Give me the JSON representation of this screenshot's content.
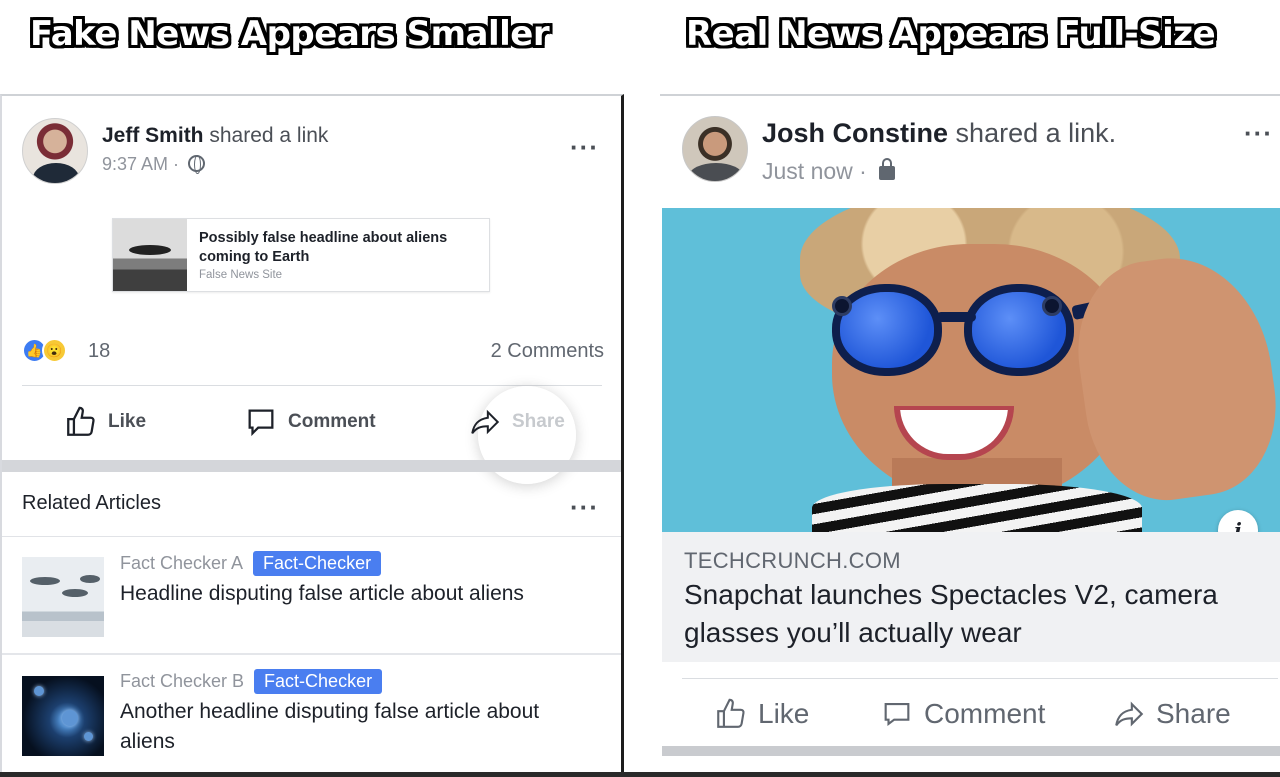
{
  "headings": {
    "left": "Fake News Appears Smaller",
    "right": "Real News Appears Full-Size"
  },
  "fake_post": {
    "author": "Jeff Smith",
    "action": "shared a link",
    "time": "9:37 AM ·",
    "privacy_icon": "globe-icon",
    "link": {
      "title": "Possibly false headline about aliens coming to Earth",
      "source": "False News Site"
    },
    "reactions": {
      "icons": [
        "like-reaction-icon",
        "wow-reaction-icon"
      ],
      "count": "18",
      "comments": "2 Comments"
    },
    "actions": {
      "like": "Like",
      "comment": "Comment",
      "share": "Share"
    },
    "related": {
      "title": "Related Articles",
      "items": [
        {
          "source": "Fact Checker A",
          "badge": "Fact-Checker",
          "headline": "Headline disputing false article about aliens",
          "thumbnail": "ufo-image"
        },
        {
          "source": "Fact Checker B",
          "badge": "Fact-Checker",
          "headline": "Another headline disputing false article about aliens",
          "thumbnail": "space-image"
        }
      ]
    }
  },
  "real_post": {
    "author": "Josh Constine",
    "action": "shared a link.",
    "time": "Just now ·",
    "privacy_icon": "lock-icon",
    "link": {
      "domain": "TECHCRUNCH.COM",
      "title": "Snapchat launches Spectacles V2, camera glasses you’ll actually wear",
      "info_label": "i"
    },
    "actions": {
      "like": "Like",
      "comment": "Comment",
      "share": "Share"
    }
  },
  "colors": {
    "badge": "#4a7ef0",
    "like_reaction": "#3d7cf2",
    "wow_reaction": "#f7c935",
    "hero_background": "#5fbfd9",
    "lens": "#1f56d8"
  }
}
